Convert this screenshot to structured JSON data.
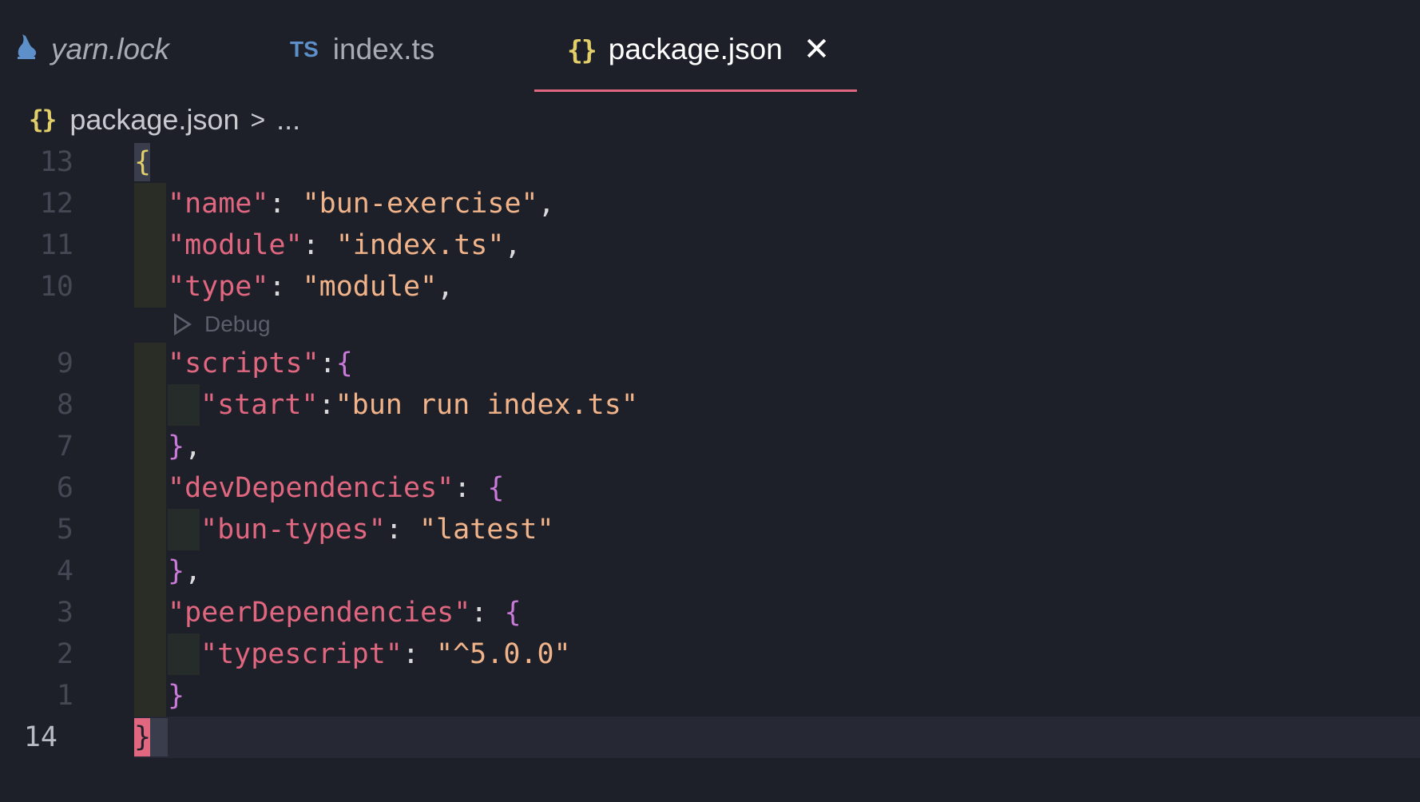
{
  "tabs": [
    {
      "label": "yarn.lock",
      "icon": "yarn-icon",
      "active": false
    },
    {
      "label": "index.ts",
      "icon": "typescript-icon",
      "icon_text": "TS",
      "active": false
    },
    {
      "label": "package.json",
      "icon": "json-braces-icon",
      "icon_text": "{}",
      "active": true
    }
  ],
  "breadcrumb": {
    "icon_text": "{}",
    "file": "package.json",
    "separator": ">",
    "more": "..."
  },
  "codelens": {
    "label": "Debug"
  },
  "line_numbers": [
    "13",
    "12",
    "11",
    "10",
    "9",
    "8",
    "7",
    "6",
    "5",
    "4",
    "3",
    "2",
    "1",
    "14"
  ],
  "code_lines": [
    [
      "{"
    ],
    [
      "\"name\"",
      ": ",
      "\"bun-exercise\"",
      ","
    ],
    [
      "\"module\"",
      ": ",
      "\"index.ts\"",
      ","
    ],
    [
      "\"type\"",
      ": ",
      "\"module\"",
      ","
    ],
    [
      "\"scripts\"",
      ":",
      "{"
    ],
    [
      "\"start\"",
      ":",
      "\"bun run index.ts\""
    ],
    [
      "}",
      ","
    ],
    [
      "\"devDependencies\"",
      ": ",
      "{"
    ],
    [
      "\"bun-types\"",
      ": ",
      "\"latest\""
    ],
    [
      "}",
      ","
    ],
    [
      "\"peerDependencies\"",
      ": ",
      "{"
    ],
    [
      "\"typescript\"",
      ": ",
      "\"^5.0.0\""
    ],
    [
      "}"
    ],
    [
      "}"
    ]
  ],
  "colors": {
    "background": "#1e2029",
    "accent": "#e0677f",
    "string": "#f1b48a",
    "bracket": "#c97ad9",
    "brace_outer": "#e2cf6a"
  }
}
